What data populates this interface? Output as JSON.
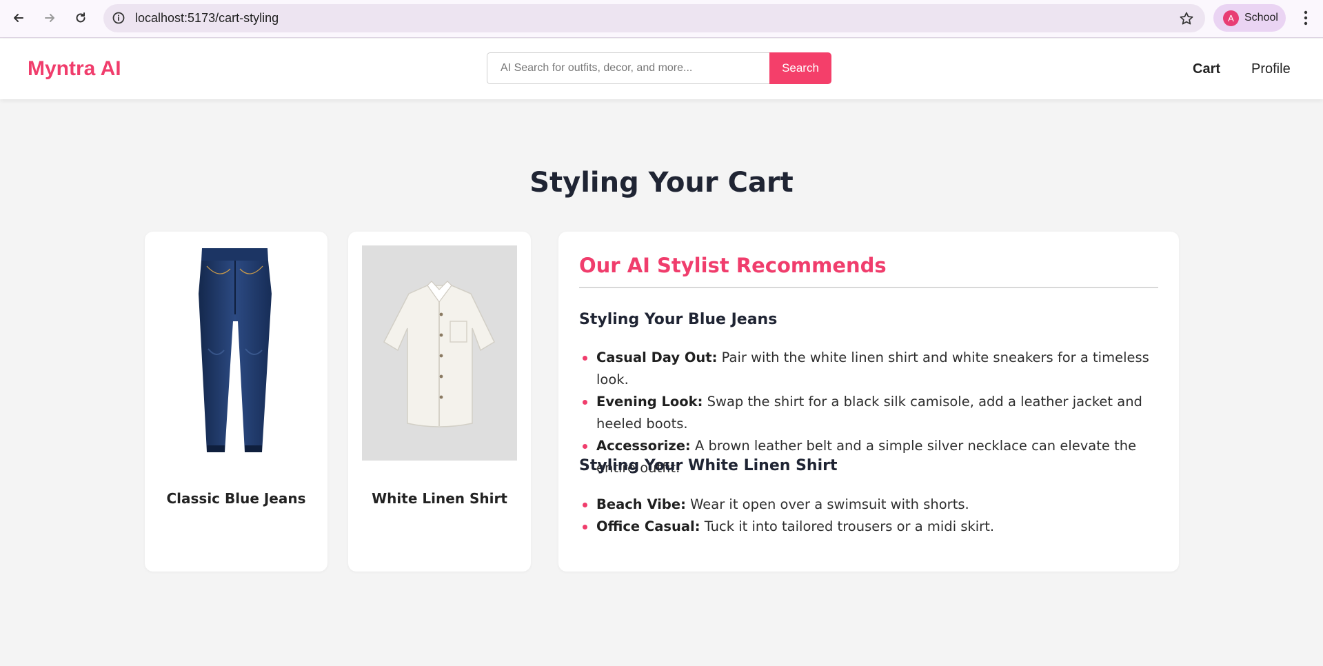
{
  "browser": {
    "url": "localhost:5173/cart-styling",
    "profile_initial": "A",
    "profile_name": "School"
  },
  "header": {
    "brand": "Myntra AI",
    "search_placeholder": "AI Search for outfits, decor, and more...",
    "search_button": "Search",
    "nav": {
      "cart": "Cart",
      "profile": "Profile"
    }
  },
  "page": {
    "title": "Styling Your Cart"
  },
  "products": [
    {
      "name": "Classic Blue Jeans",
      "image": "blue-jeans-image"
    },
    {
      "name": "White Linen Shirt",
      "image": "white-linen-shirt-image"
    }
  ],
  "recommendations": {
    "title": "Our AI Stylist Recommends",
    "sections": [
      {
        "heading": "Styling Your Blue Jeans",
        "items": [
          {
            "label": "Casual Day Out:",
            "text": "Pair with the white linen shirt and white sneakers for a timeless look."
          },
          {
            "label": "Evening Look:",
            "text": "Swap the shirt for a black silk camisole, add a leather jacket and heeled boots."
          },
          {
            "label": "Accessorize:",
            "text": "A brown leather belt and a simple silver necklace can elevate the entire outfit."
          }
        ]
      },
      {
        "heading": "Styling Your White Linen Shirt",
        "items": [
          {
            "label": "Beach Vibe:",
            "text": "Wear it open over a swimsuit with shorts."
          },
          {
            "label": "Office Casual:",
            "text": "Tuck it into tailored trousers or a midi skirt."
          }
        ]
      }
    ]
  },
  "colors": {
    "accent": "#f03d6c",
    "page_background": "#f4f4f4",
    "heading": "#1f2433"
  }
}
